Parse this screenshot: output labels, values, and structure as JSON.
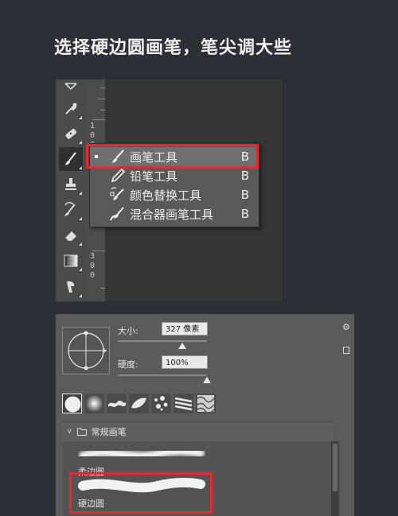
{
  "heading": "选择硬边圆画笔，笔尖调大些",
  "ruler": {
    "digits_top": [
      "1",
      "0",
      "0"
    ],
    "digits_bottom": [
      "3",
      "0",
      "0"
    ]
  },
  "toolbar": {
    "tools": [
      "frame-tool-icon",
      "eyedropper-icon",
      "spot-healing-brush-icon",
      "brush-icon",
      "clone-stamp-icon",
      "history-brush-icon",
      "eraser-icon",
      "gradient-icon",
      "smudge-icon"
    ],
    "active_tool": "brush-icon"
  },
  "flyout": {
    "items": [
      {
        "label": "画笔工具",
        "key": "B",
        "icon": "brush-icon",
        "selected": true
      },
      {
        "label": "铅笔工具",
        "key": "B",
        "icon": "pencil-icon",
        "selected": false
      },
      {
        "label": "颜色替换工具",
        "key": "B",
        "icon": "color-replacement-icon",
        "selected": false
      },
      {
        "label": "混合器画笔工具",
        "key": "B",
        "icon": "mixer-brush-icon",
        "selected": false
      }
    ]
  },
  "brush_settings": {
    "size_label": "大小:",
    "size_value": "327 像素",
    "hardness_label": "硬度:",
    "hardness_value": "100%",
    "size_fraction": 0.72,
    "hardness_fraction": 1.0
  },
  "brush_list": {
    "folder_label": "常规画笔",
    "items": [
      {
        "name": "柔边圆"
      },
      {
        "name": "硬边圆"
      }
    ]
  },
  "colors": {
    "highlight": "#e02a34",
    "accent": "#ffffff"
  }
}
